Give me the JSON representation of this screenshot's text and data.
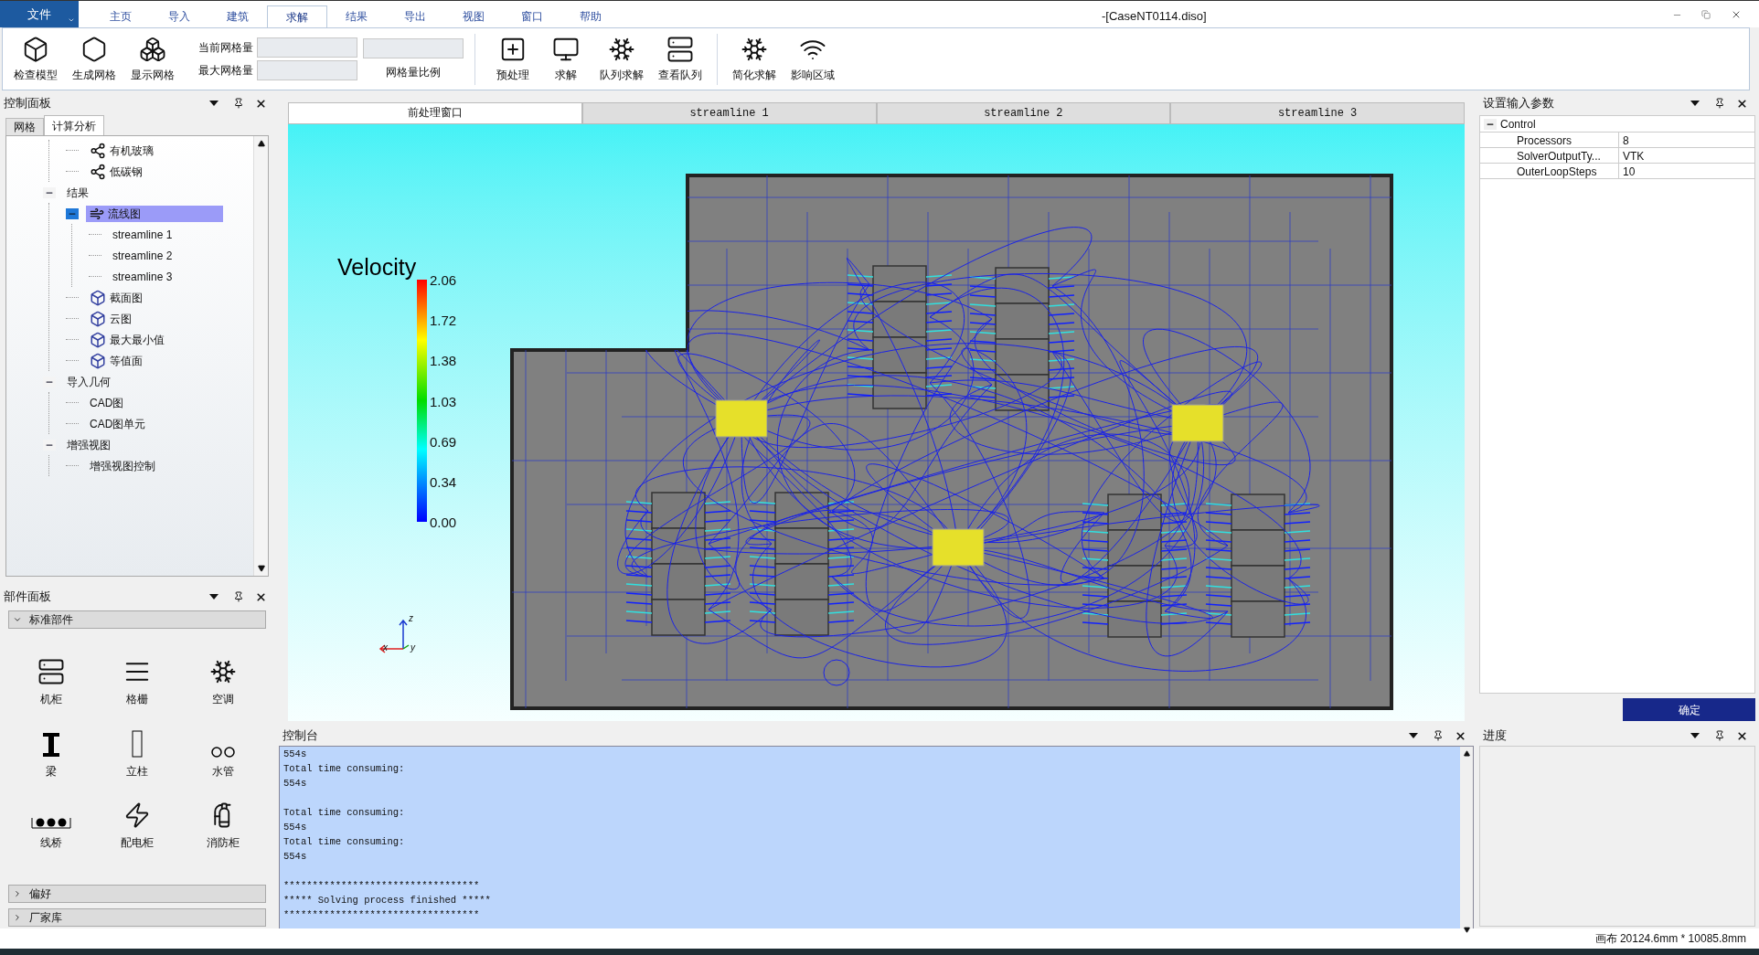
{
  "window": {
    "title": "-[CaseNT0114.diso]"
  },
  "file_menu": "文件",
  "ribbon_tabs": [
    {
      "label": "主页",
      "selected": false
    },
    {
      "label": "导入",
      "selected": false
    },
    {
      "label": "建筑",
      "selected": false
    },
    {
      "label": "求解",
      "selected": true
    },
    {
      "label": "结果",
      "selected": false
    },
    {
      "label": "导出",
      "selected": false
    },
    {
      "label": "视图",
      "selected": false
    },
    {
      "label": "窗口",
      "selected": false
    },
    {
      "label": "帮助",
      "selected": false
    }
  ],
  "ribbon": {
    "mesh_buttons": [
      "检查模型",
      "生成网格",
      "显示网格"
    ],
    "mesh_fields": [
      {
        "label": "当前网格量"
      },
      {
        "label": "最大网格量"
      }
    ],
    "ratio_label": "网格量比例",
    "solve_buttons": [
      "预处理",
      "求解",
      "队列求解",
      "查看队列"
    ],
    "extra_buttons": [
      "简化求解",
      "影响区域"
    ]
  },
  "control_panel": {
    "title": "控制面板",
    "tabs": [
      {
        "label": "网格",
        "selected": false
      },
      {
        "label": "计算分析",
        "selected": true
      }
    ],
    "tree": [
      {
        "children": [
          {
            "label": "有机玻璃",
            "kind": "material",
            "selected": false
          },
          {
            "label": "低碳钢",
            "kind": "material",
            "selected": false
          }
        ]
      },
      {
        "label": "结果",
        "kind": "group",
        "expanded": true,
        "selected": false,
        "children": [
          {
            "label": "流线图",
            "kind": "streamlines",
            "expanded": true,
            "selected": true,
            "children": [
              {
                "label": "streamline 1",
                "kind": "item",
                "selected": false
              },
              {
                "label": "streamline 2",
                "kind": "item",
                "selected": false
              },
              {
                "label": "streamline 3",
                "kind": "item",
                "selected": false
              }
            ]
          },
          {
            "label": "截面图",
            "kind": "plot",
            "selected": false
          },
          {
            "label": "云图",
            "kind": "plot",
            "selected": false
          },
          {
            "label": "最大最小值",
            "kind": "plot",
            "selected": false
          },
          {
            "label": "等值面",
            "kind": "plot",
            "selected": false
          }
        ]
      },
      {
        "label": "导入几何",
        "kind": "group",
        "expanded": true,
        "selected": false,
        "children": [
          {
            "label": "CAD图",
            "kind": "item",
            "selected": false
          },
          {
            "label": "CAD图单元",
            "kind": "item",
            "selected": false
          }
        ]
      },
      {
        "label": "增强视图",
        "kind": "group",
        "expanded": true,
        "selected": false,
        "children": [
          {
            "label": "增强视图控制",
            "kind": "item",
            "selected": false
          }
        ]
      }
    ]
  },
  "parts_panel": {
    "title": "部件面板",
    "sections": [
      {
        "label": "标准部件",
        "expanded": true,
        "items": [
          "机柜",
          "格栅",
          "空调",
          "梁",
          "立柱",
          "水管",
          "线桥",
          "配电柜",
          "消防柜"
        ]
      },
      {
        "label": "偏好",
        "expanded": false
      },
      {
        "label": "厂家库",
        "expanded": false
      }
    ]
  },
  "viewport_tabs": [
    {
      "label": "前处理窗口",
      "selected": true
    },
    {
      "label": "streamline 1",
      "selected": false
    },
    {
      "label": "streamline 2",
      "selected": false
    },
    {
      "label": "streamline 3",
      "selected": false
    }
  ],
  "viewport": {
    "legend_title": "Velocity",
    "legend_ticks": [
      "2.06",
      "1.72",
      "1.38",
      "1.03",
      "0.69",
      "0.34",
      "0.00"
    ],
    "axes": [
      "z",
      "x",
      "y"
    ]
  },
  "console": {
    "title": "控制台",
    "blocks": [
      [
        "554s",
        "Total time consuming:",
        "554s"
      ],
      [
        "Total time consuming:",
        "554s",
        "Total time consuming:",
        "554s"
      ],
      [
        "**********************************",
        "***** Solving process finished *****",
        "**********************************"
      ]
    ]
  },
  "params_panel": {
    "title": "设置输入参数",
    "group": {
      "label": "Control",
      "expanded": true
    },
    "rows": [
      {
        "name": "Processors",
        "value": "8"
      },
      {
        "name": "SolverOutputTy...",
        "value": "VTK"
      },
      {
        "name": "OuterLoopSteps",
        "value": "10"
      }
    ],
    "confirm": "确定"
  },
  "progress_panel": {
    "title": "进度"
  },
  "status_bar": "画布 20124.6mm * 10085.8mm"
}
